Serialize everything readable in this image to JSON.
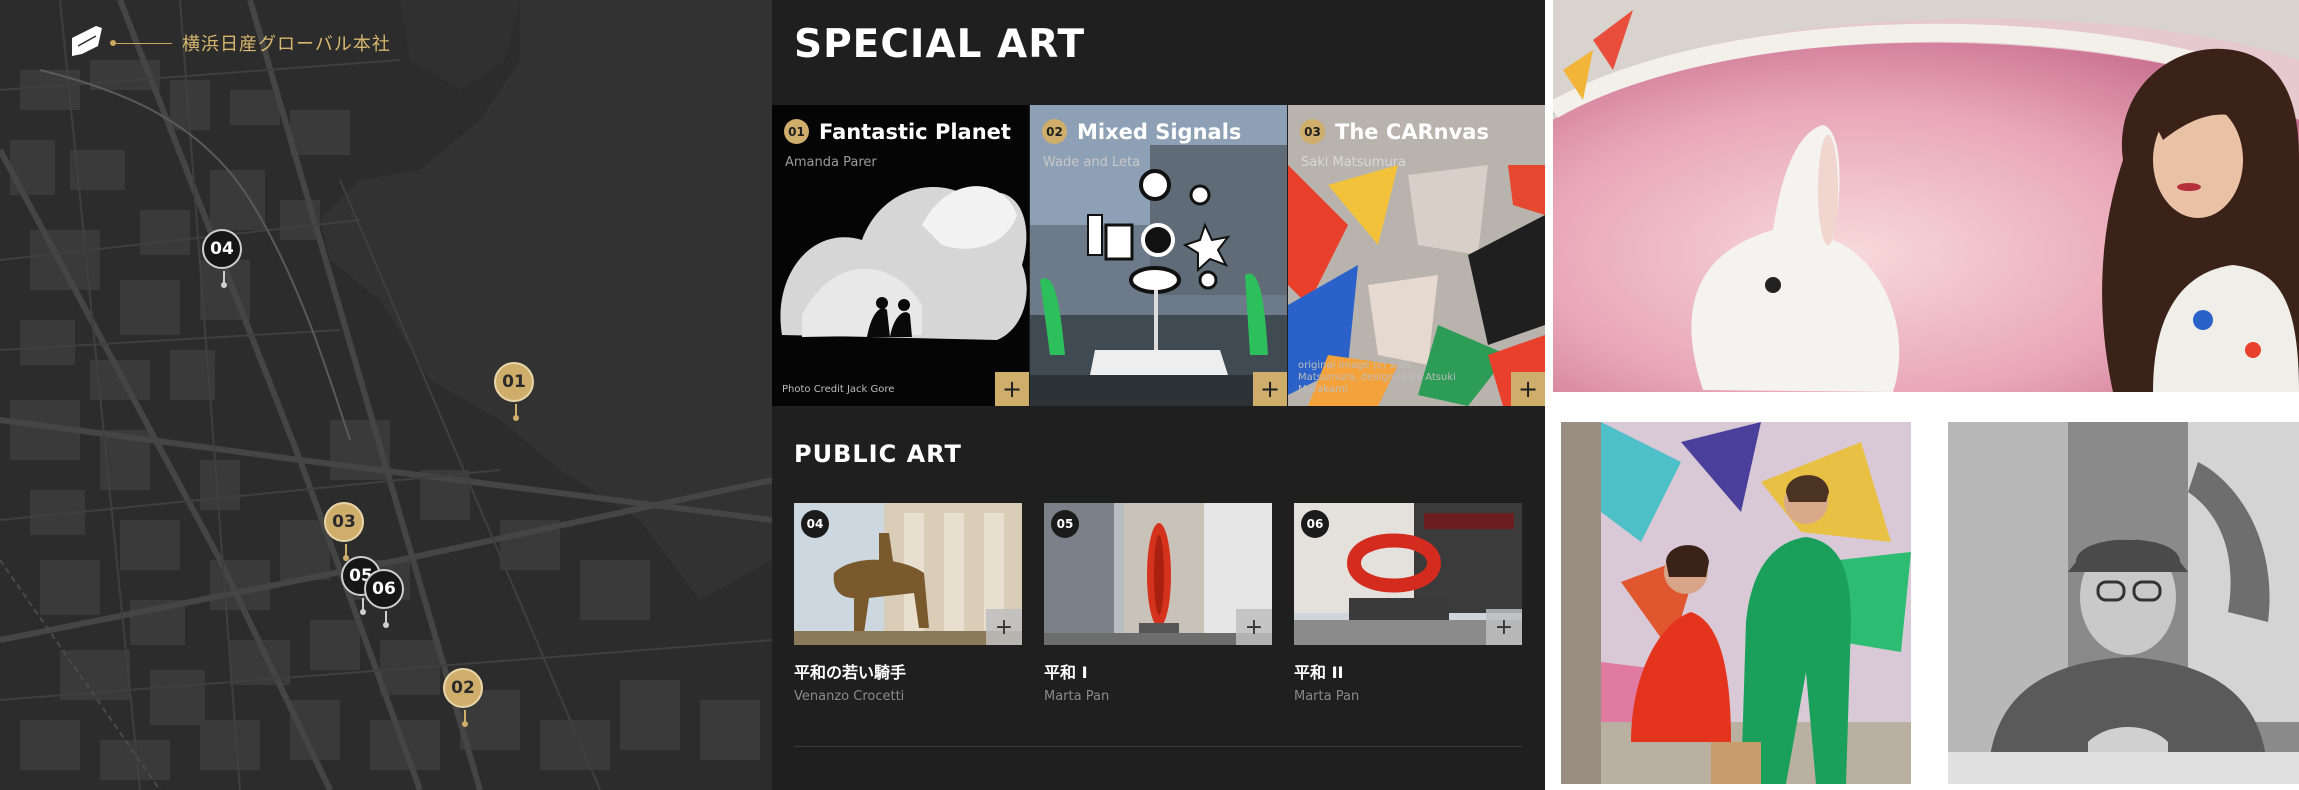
{
  "map": {
    "location_label": "横浜日産グローバル本社",
    "pins": [
      {
        "label": "01",
        "style": "gold"
      },
      {
        "label": "02",
        "style": "gold"
      },
      {
        "label": "03",
        "style": "gold"
      },
      {
        "label": "04",
        "style": "black"
      },
      {
        "label": "05",
        "style": "black"
      },
      {
        "label": "06",
        "style": "black"
      }
    ]
  },
  "special_art": {
    "title": "SPECIAL ART",
    "items": [
      {
        "num": "01",
        "title": "Fantastic Planet",
        "artist": "Amanda Parer",
        "credit": "Photo Credit Jack Gore"
      },
      {
        "num": "02",
        "title": "Mixed Signals",
        "artist": "Wade and Leta",
        "credit": ""
      },
      {
        "num": "03",
        "title": "The CARnvas",
        "artist": "Saki Matsumura",
        "credit": "original image (c) Saki Matsumura, designed by Atsuki Murakami"
      }
    ],
    "plus_label": "+"
  },
  "public_art": {
    "title": "PUBLIC ART",
    "items": [
      {
        "num": "04",
        "title": "平和の若い騎手",
        "artist": "Venanzo Crocetti"
      },
      {
        "num": "05",
        "title": "平和 I",
        "artist": "Marta Pan"
      },
      {
        "num": "06",
        "title": "平和 II",
        "artist": "Marta Pan"
      }
    ],
    "plus_label": "+"
  },
  "colors": {
    "gold": "#cfae6b",
    "panel_bg": "#1f1f1f",
    "map_bg": "#2b2b2b"
  }
}
